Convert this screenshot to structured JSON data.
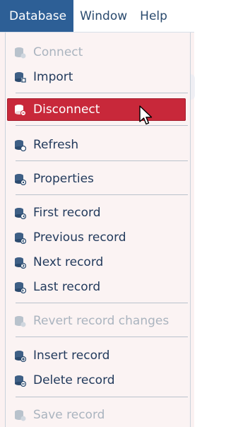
{
  "menubar": {
    "items": [
      {
        "label": "Database",
        "active": true
      },
      {
        "label": "Window",
        "active": false
      },
      {
        "label": "Help",
        "active": false
      }
    ]
  },
  "menu": {
    "items": [
      {
        "label": "Connect",
        "icon": "database-connect-icon",
        "state": "disabled"
      },
      {
        "label": "Import",
        "icon": "database-import-icon",
        "state": "enabled"
      },
      {
        "label": "Disconnect",
        "icon": "database-disconnect-icon",
        "state": "highlighted"
      },
      {
        "label": "Refresh",
        "icon": "database-refresh-icon",
        "state": "enabled"
      },
      {
        "label": "Properties",
        "icon": "database-properties-icon",
        "state": "enabled"
      },
      {
        "label": "First record",
        "icon": "first-record-icon",
        "state": "enabled"
      },
      {
        "label": "Previous record",
        "icon": "previous-record-icon",
        "state": "enabled"
      },
      {
        "label": "Next record",
        "icon": "next-record-icon",
        "state": "enabled"
      },
      {
        "label": "Last record",
        "icon": "last-record-icon",
        "state": "enabled"
      },
      {
        "label": "Revert record changes",
        "icon": "revert-record-icon",
        "state": "disabled"
      },
      {
        "label": "Insert record",
        "icon": "insert-record-icon",
        "state": "enabled"
      },
      {
        "label": "Delete record",
        "icon": "delete-record-icon",
        "state": "enabled"
      },
      {
        "label": "Save record",
        "icon": "save-record-icon",
        "state": "disabled"
      }
    ]
  },
  "colors": {
    "menubar_active": "#2d5f96",
    "highlight": "#c8283a",
    "text": "#223a5c",
    "disabled_text": "#aab4bf"
  }
}
